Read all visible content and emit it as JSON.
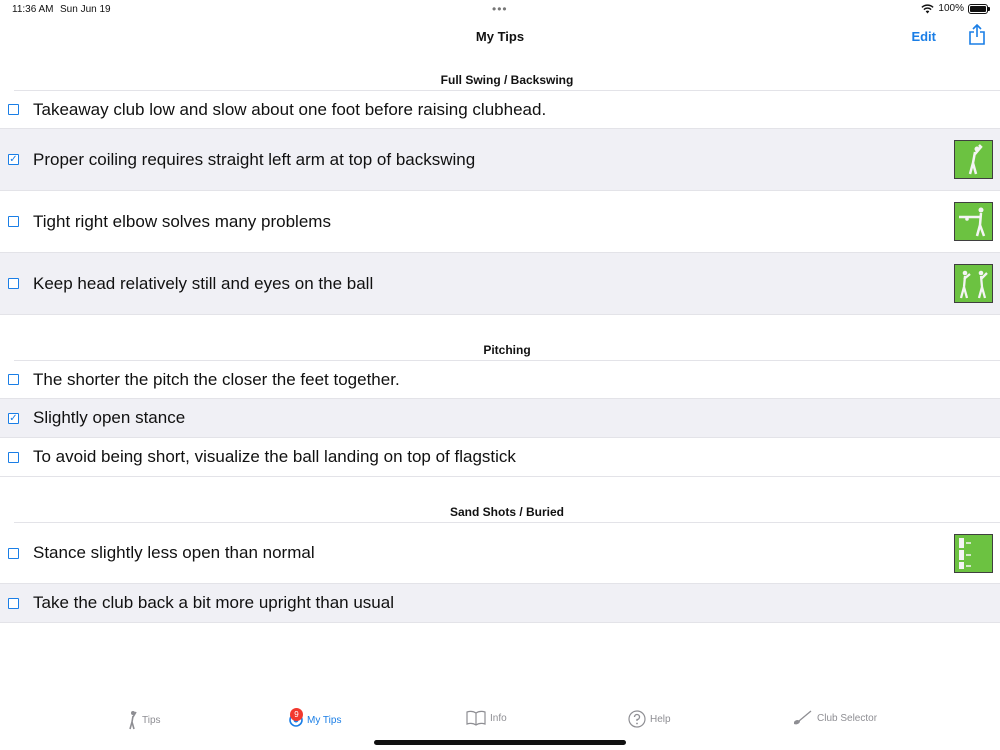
{
  "status_bar": {
    "time": "11:36 AM",
    "date": "Sun Jun 19",
    "battery": "100%",
    "icons": [
      "wifi-icon",
      "battery-icon"
    ]
  },
  "nav": {
    "title": "My Tips",
    "edit_label": "Edit",
    "share_icon": "share-icon"
  },
  "sections": [
    {
      "title": "Full Swing / Backswing",
      "tips": [
        {
          "text": "Takeaway club low and slow about one foot before raising clubhead.",
          "checked": false,
          "thumbnail": false
        },
        {
          "text": "Proper coiling requires straight left arm at top of backswing",
          "checked": true,
          "thumbnail": true
        },
        {
          "text": "Tight right elbow solves many problems",
          "checked": false,
          "thumbnail": true
        },
        {
          "text": "Keep head relatively still and eyes on the ball",
          "checked": false,
          "thumbnail": true
        }
      ]
    },
    {
      "title": "Pitching",
      "tips": [
        {
          "text": "The shorter the pitch the closer the feet together.",
          "checked": false,
          "thumbnail": false
        },
        {
          "text": "Slightly open stance",
          "checked": true,
          "thumbnail": false
        },
        {
          "text": "To avoid being short, visualize the ball landing on top of flagstick",
          "checked": false,
          "thumbnail": false
        }
      ]
    },
    {
      "title": "Sand Shots / Buried",
      "tips": [
        {
          "text": "Stance slightly less open than normal",
          "checked": false,
          "thumbnail": true
        },
        {
          "text": "Take the club back a bit more upright than usual",
          "checked": false,
          "thumbnail": false
        }
      ]
    }
  ],
  "tab_bar": {
    "tabs": [
      {
        "label": "Tips",
        "icon": "golfer-icon"
      },
      {
        "label": "My Tips",
        "icon": "target-icon",
        "badge": "9",
        "active": true
      },
      {
        "label": "Info",
        "icon": "book-icon"
      },
      {
        "label": "Help",
        "icon": "question-icon"
      },
      {
        "label": "Club Selector",
        "icon": "club-icon"
      }
    ]
  },
  "colors": {
    "accent": "#1a7ee6",
    "row_alt": "#f0f0f5",
    "thumbnail_green": "#6cc241",
    "badge_red": "#f2382e"
  }
}
